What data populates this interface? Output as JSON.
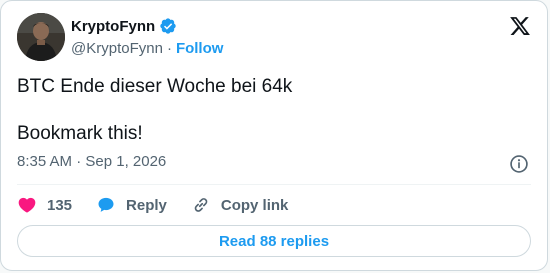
{
  "author": {
    "display_name": "KryptoFynn",
    "handle": "@KryptoFynn",
    "follow_label": "Follow",
    "separator": "·"
  },
  "tweet": {
    "line1": "BTC Ende dieser Woche bei 64k",
    "line2": "Bookmark this!",
    "timestamp": "8:35 AM · Sep 1, 2026"
  },
  "actions": {
    "like_count": "135",
    "reply_label": "Reply",
    "copy_label": "Copy link"
  },
  "read_replies_label": "Read 88 replies",
  "colors": {
    "accent": "#1d9bf0",
    "like": "#f91880",
    "secondary_text": "#536471",
    "border": "#cfd9de"
  },
  "icons": [
    "verified-badge-icon",
    "x-logo-icon",
    "info-icon",
    "heart-icon",
    "reply-bubble-icon",
    "link-icon"
  ]
}
